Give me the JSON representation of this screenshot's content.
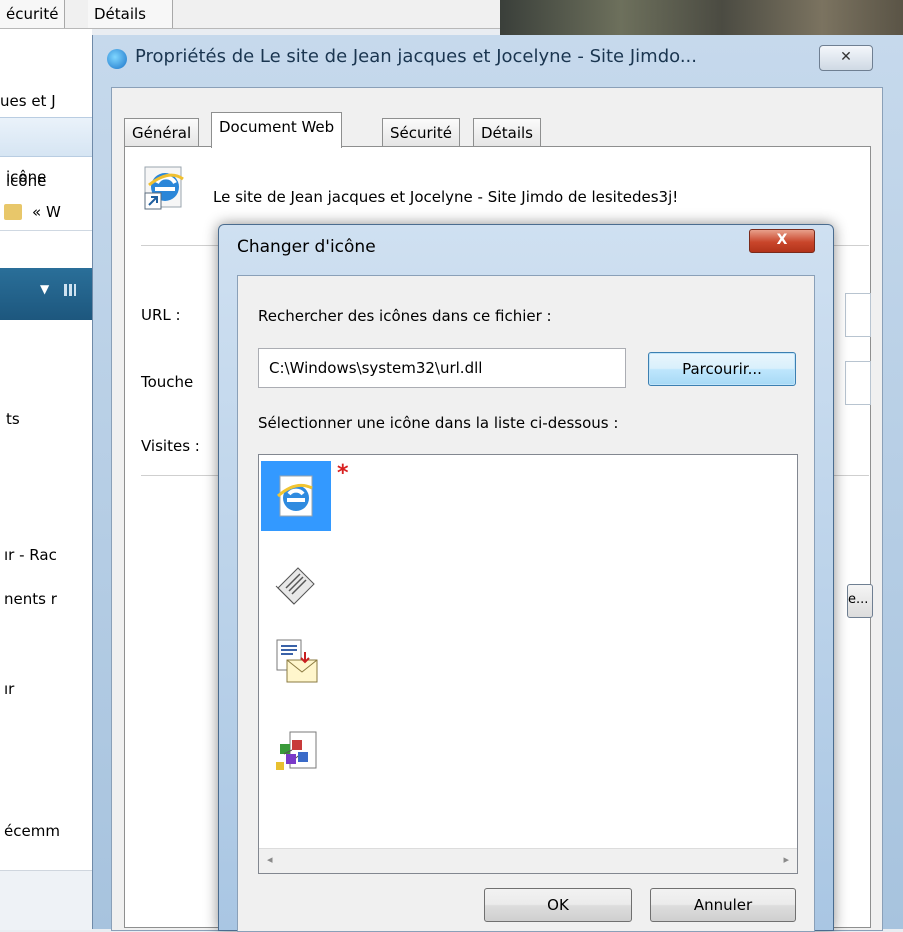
{
  "background": {
    "tabs": [
      "écurité",
      "Détails"
    ],
    "sidebar_texts": [
      "ues et J",
      "icône",
      "« W",
      "ts",
      "ır - Rac",
      "nents r",
      "ır",
      "écemm"
    ]
  },
  "properties_dialog": {
    "title": "Propriétés de Le site de Jean jacques et Jocelyne - Site Jimdo...",
    "close_label": "✕",
    "tabs": [
      "Général",
      "Document Web",
      "Sécurité",
      "Détails"
    ],
    "active_tab": "Document Web",
    "site_name": "Le site de Jean jacques et Jocelyne - Site Jimdo de lesitedes3j!",
    "fields": {
      "url_label": "URL :",
      "hotkey_label": "Touche",
      "visits_label": "Visites :"
    },
    "side_button_label": "e..."
  },
  "change_icon_dialog": {
    "title": "Changer d'icône",
    "close_label": "X",
    "search_label": "Rechercher des icônes dans ce fichier :",
    "path_value": "C:\\Windows\\system32\\url.dll",
    "browse_label": "Parcourir...",
    "select_label": "Sélectionner une icône dans la liste ci-dessous :",
    "icons": [
      "internet-explorer-icon",
      "newspaper-icon",
      "mail-document-icon",
      "colored-cubes-document-icon"
    ],
    "selected_icon_index": 0,
    "ok_label": "OK",
    "cancel_label": "Annuler"
  }
}
